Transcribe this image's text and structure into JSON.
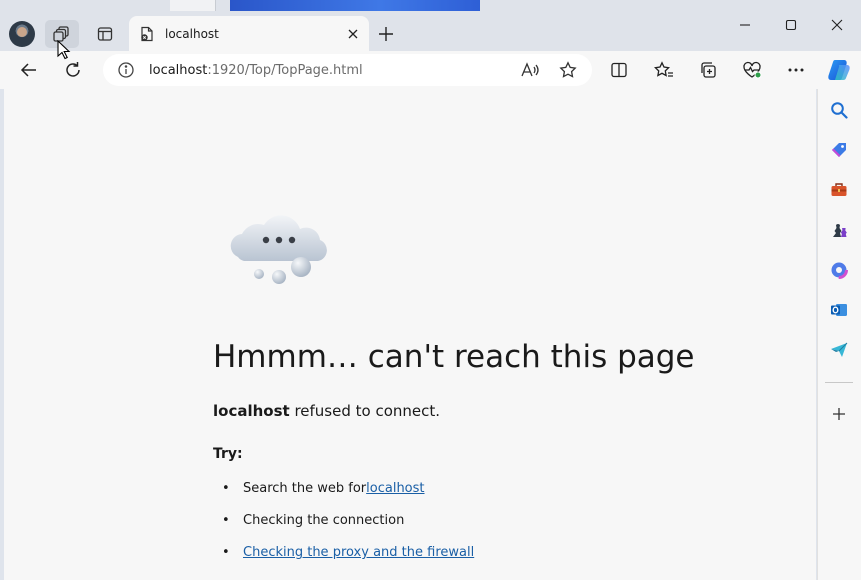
{
  "window": {
    "tab": {
      "title": "localhost"
    }
  },
  "addressbar": {
    "url_host": "localhost",
    "url_rest": ":1920/Top/TopPage.html"
  },
  "error_page": {
    "headline": "Hmmm… can't reach this page",
    "host": "localhost",
    "refused_suffix": " refused to connect.",
    "try_label": "Try:",
    "suggestions": {
      "search_prefix": "Search the web for ",
      "search_link": "localhost",
      "connection": "Checking the connection",
      "proxy_link": "Checking the proxy and the firewall"
    }
  },
  "colors": {
    "link": "#1a5fa6",
    "page_bg": "#f7f7f7",
    "titlebar_bg": "#dfe3ea"
  },
  "sidebar": {
    "icons": [
      "search-icon",
      "shopping-tag-icon",
      "toolbox-icon",
      "games-icon",
      "microsoft365-icon",
      "outlook-icon",
      "send-icon",
      "add-icon"
    ]
  }
}
